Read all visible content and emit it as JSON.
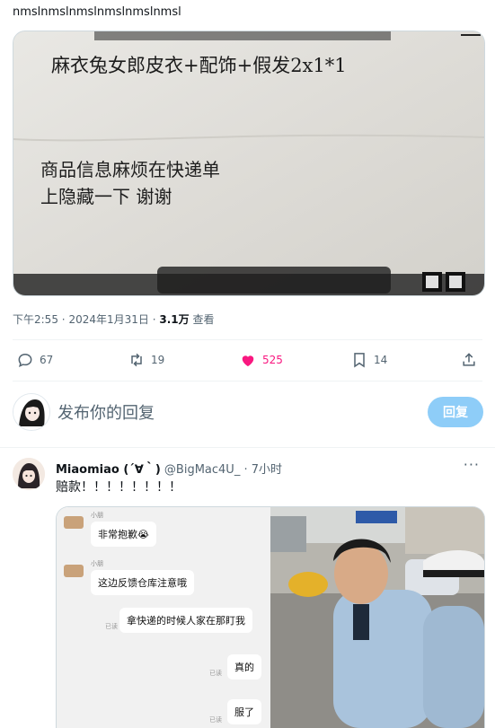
{
  "tweet": {
    "text": "nmslnmslnmslnmslnmslnmsl",
    "photo_lines": {
      "top_partial": "麻衣兔女郎皮衣+配饰+假发2x1*1",
      "note_line1": "商品信息麻烦在快递单",
      "note_line2": "上隐藏一下 谢谢"
    },
    "meta": {
      "time": "下午2:55",
      "dot": "·",
      "date": "2024年1月31日",
      "views_count": "3.1万",
      "views_label": "查看"
    }
  },
  "actions": {
    "replies": "67",
    "retweets": "19",
    "likes": "525",
    "bookmarks": "14"
  },
  "reply_box": {
    "placeholder": "发布你的回复",
    "button_label": "回复"
  },
  "comment": {
    "name": "Miaomiao (´∀｀)",
    "handle": "@BigMac4U_",
    "time": "· 7小时",
    "more": "···",
    "text": "赔款！！！！！！！！",
    "chat": {
      "sender": "小朋",
      "messages": [
        {
          "side": "left",
          "text": "非常抱歉😭"
        },
        {
          "side": "left",
          "text": "这边反馈仓库注意哦"
        },
        {
          "side": "right",
          "text": "拿快递的时候人家在那盯我",
          "read": "已读"
        },
        {
          "side": "right",
          "text": "真的",
          "read": "已读"
        },
        {
          "side": "right",
          "text": "服了",
          "read": "已读"
        }
      ]
    }
  },
  "colors": {
    "like": "#f91880",
    "reply_button": "#8ecdf8",
    "muted": "#536471"
  }
}
